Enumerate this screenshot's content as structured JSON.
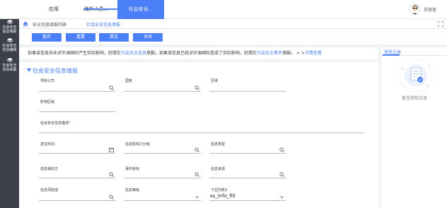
{
  "topbar": {
    "tabs": [
      {
        "label": "应用"
      },
      {
        "label": "海外人员..."
      },
      {
        "label": "社会安全..."
      }
    ],
    "username": "郑蓓蓓"
  },
  "sidebar": {
    "items": [
      {
        "line1": "社会安全",
        "line2": "信息填报"
      },
      {
        "line1": "社会安全",
        "line2": "信息编辑"
      },
      {
        "line1": "社会安全",
        "line2": "信息采集"
      }
    ]
  },
  "breadcrumb": {
    "items": [
      "安全信息填报列表",
      "社会安全信息填报"
    ]
  },
  "toolbar": {
    "buttons": [
      "暂存",
      "重置",
      "提交",
      "关闭"
    ]
  },
  "notice": {
    "part1": "如果该信息尚未对中油国际产生实际影响，则请在",
    "link1": "社会安全信息",
    "part2": "填报；如果该信息已经对中油国际造成了实际影响，则请在",
    "link2": "社会安全事件",
    "part3": "填报。",
    "arrows": " > >",
    "link3": "详情查看"
  },
  "form": {
    "section_title": "社会安全信息填报",
    "labels": {
      "company": "项目公司",
      "country": "国家",
      "region": "区域",
      "impact_area": "影响区域",
      "description": "社会安全信息描述*",
      "occur_time": "发生时间",
      "impact_level": "信息影响力分级",
      "info_type": "信息类型",
      "related_party": "信息相关方",
      "event_target": "事件目标",
      "info_source": "信息来源",
      "risk_level": "信息风险值",
      "info_grade": "信息等级",
      "dropdown": "下拉列表3"
    },
    "dropdown_value": "ss_info_fill"
  },
  "right_panel": {
    "tab": "审批记录",
    "empty": "暂无审批记录"
  },
  "colors": {
    "accent": "#4a7ff7",
    "sidebar": "#3c4049"
  }
}
